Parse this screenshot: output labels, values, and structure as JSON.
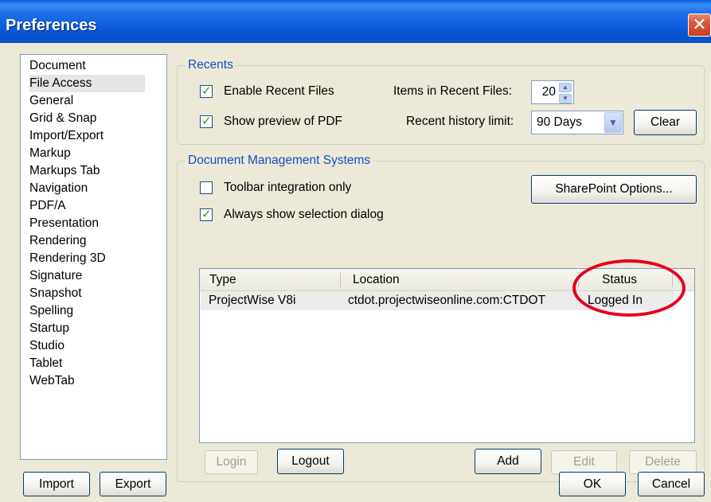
{
  "window": {
    "title": "Preferences"
  },
  "categories": [
    "Document",
    "File Access",
    "General",
    "Grid & Snap",
    "Import/Export",
    "Markup",
    "Markups Tab",
    "Navigation",
    "PDF/A",
    "Presentation",
    "Rendering",
    "Rendering 3D",
    "Signature",
    "Snapshot",
    "Spelling",
    "Startup",
    "Studio",
    "Tablet",
    "WebTab"
  ],
  "selected_category": "File Access",
  "recents": {
    "group_label": "Recents",
    "enable_recent_label": "Enable Recent Files",
    "enable_recent_checked": true,
    "show_preview_label": "Show preview of PDF",
    "show_preview_checked": true,
    "items_label": "Items in Recent Files:",
    "items_value": "20",
    "history_label": "Recent history limit:",
    "history_value": "90 Days",
    "clear_label": "Clear"
  },
  "dms": {
    "group_label": "Document Management Systems",
    "toolbar_only_label": "Toolbar integration only",
    "toolbar_only_checked": false,
    "always_show_label": "Always show selection dialog",
    "always_show_checked": true,
    "sharepoint_label": "SharePoint Options...",
    "columns": [
      "Type",
      "Location",
      "Status"
    ],
    "rows": [
      {
        "type": "ProjectWise V8i",
        "location": "ctdot.projectwiseonline.com:CTDOT",
        "status": "Logged In"
      }
    ],
    "login_label": "Login",
    "logout_label": "Logout",
    "add_label": "Add",
    "edit_label": "Edit",
    "delete_label": "Delete"
  },
  "footer": {
    "import_label": "Import",
    "export_label": "Export",
    "ok_label": "OK",
    "cancel_label": "Cancel"
  },
  "icons": {
    "close": "close-icon",
    "check": "check-icon",
    "spin-up": "chevron-up-icon",
    "spin-down": "chevron-down-icon",
    "dropdown": "chevron-down-icon"
  },
  "colors": {
    "titlebar": "#0b58d8",
    "group_label": "#1c4dbf",
    "annotation": "#e3001b"
  }
}
